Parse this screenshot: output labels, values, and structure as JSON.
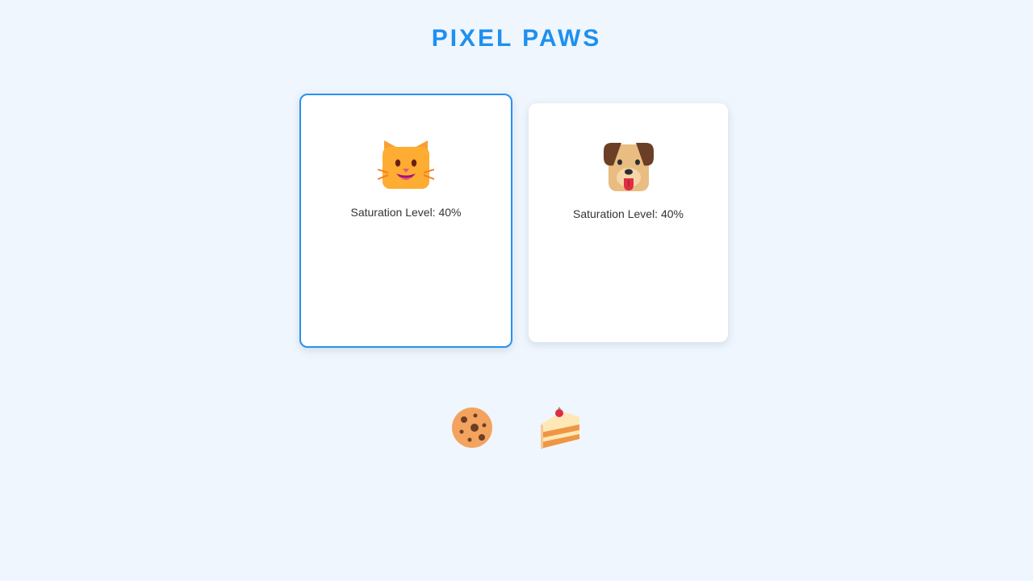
{
  "app": {
    "title": "PIXEL PAWS",
    "accent_color": "#1e90f0"
  },
  "pets": [
    {
      "name": "cat",
      "icon": "cat-face-icon",
      "saturation_text": "Saturation Level: 40%",
      "saturation_level": 40,
      "selected": true
    },
    {
      "name": "dog",
      "icon": "dog-face-icon",
      "saturation_text": "Saturation Level: 40%",
      "saturation_level": 40,
      "selected": false
    }
  ],
  "foods": [
    {
      "name": "cookie",
      "icon": "cookie-icon"
    },
    {
      "name": "cake",
      "icon": "cake-slice-icon"
    }
  ]
}
